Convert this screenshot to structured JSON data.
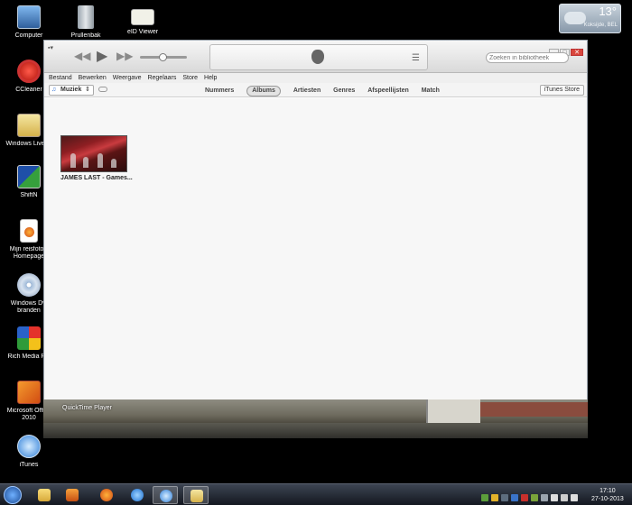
{
  "desktop_icons": [
    {
      "label": "Computer",
      "icon": "computer-icon"
    },
    {
      "label": "Prullenbak",
      "icon": "recycle-bin-icon"
    },
    {
      "label": "eID Viewer",
      "icon": "eid-viewer-icon"
    },
    {
      "label": "CCleaner",
      "icon": "ccleaner-icon"
    },
    {
      "label": "Windows Live M",
      "icon": "windows-live-mail-icon"
    },
    {
      "label": "ShiftN",
      "icon": "shiftn-icon"
    },
    {
      "label": "Mijn reisfoto's",
      "label2": "Homepage",
      "icon": "firefox-doc-icon"
    },
    {
      "label": "Windows Dvi",
      "label2": "branden",
      "icon": "dvd-icon"
    },
    {
      "label": "Rich Media Pla",
      "icon": "rich-media-player-icon"
    },
    {
      "label": "Microsoft Office",
      "label2": "2010",
      "icon": "office-icon"
    },
    {
      "label": "iTunes",
      "icon": "itunes-icon"
    }
  ],
  "weather": {
    "temperature": "13°",
    "location": "Koksijde, BEL"
  },
  "itunes": {
    "search_placeholder": "Zoeken in bibliotheek",
    "menu": [
      "Bestand",
      "Bewerken",
      "Weergave",
      "Regelaars",
      "Store",
      "Help"
    ],
    "source": "Muziek",
    "tabs": [
      "Nummers",
      "Albums",
      "Artiesten",
      "Genres",
      "Afspeellijsten",
      "Match"
    ],
    "active_tab": "Albums",
    "store_button": "iTunes Store",
    "albums": [
      {
        "title": "JAMES LAST - Games..."
      }
    ],
    "volume": 0.5
  },
  "quicktime": {
    "label": "QuickTime Player"
  },
  "clock": {
    "time": "17:10",
    "date": "27-10-2013"
  },
  "colors": {
    "accent": "#2f6fd2",
    "window_bg": "#f7f7f7",
    "taskbar": "#1c2230"
  }
}
